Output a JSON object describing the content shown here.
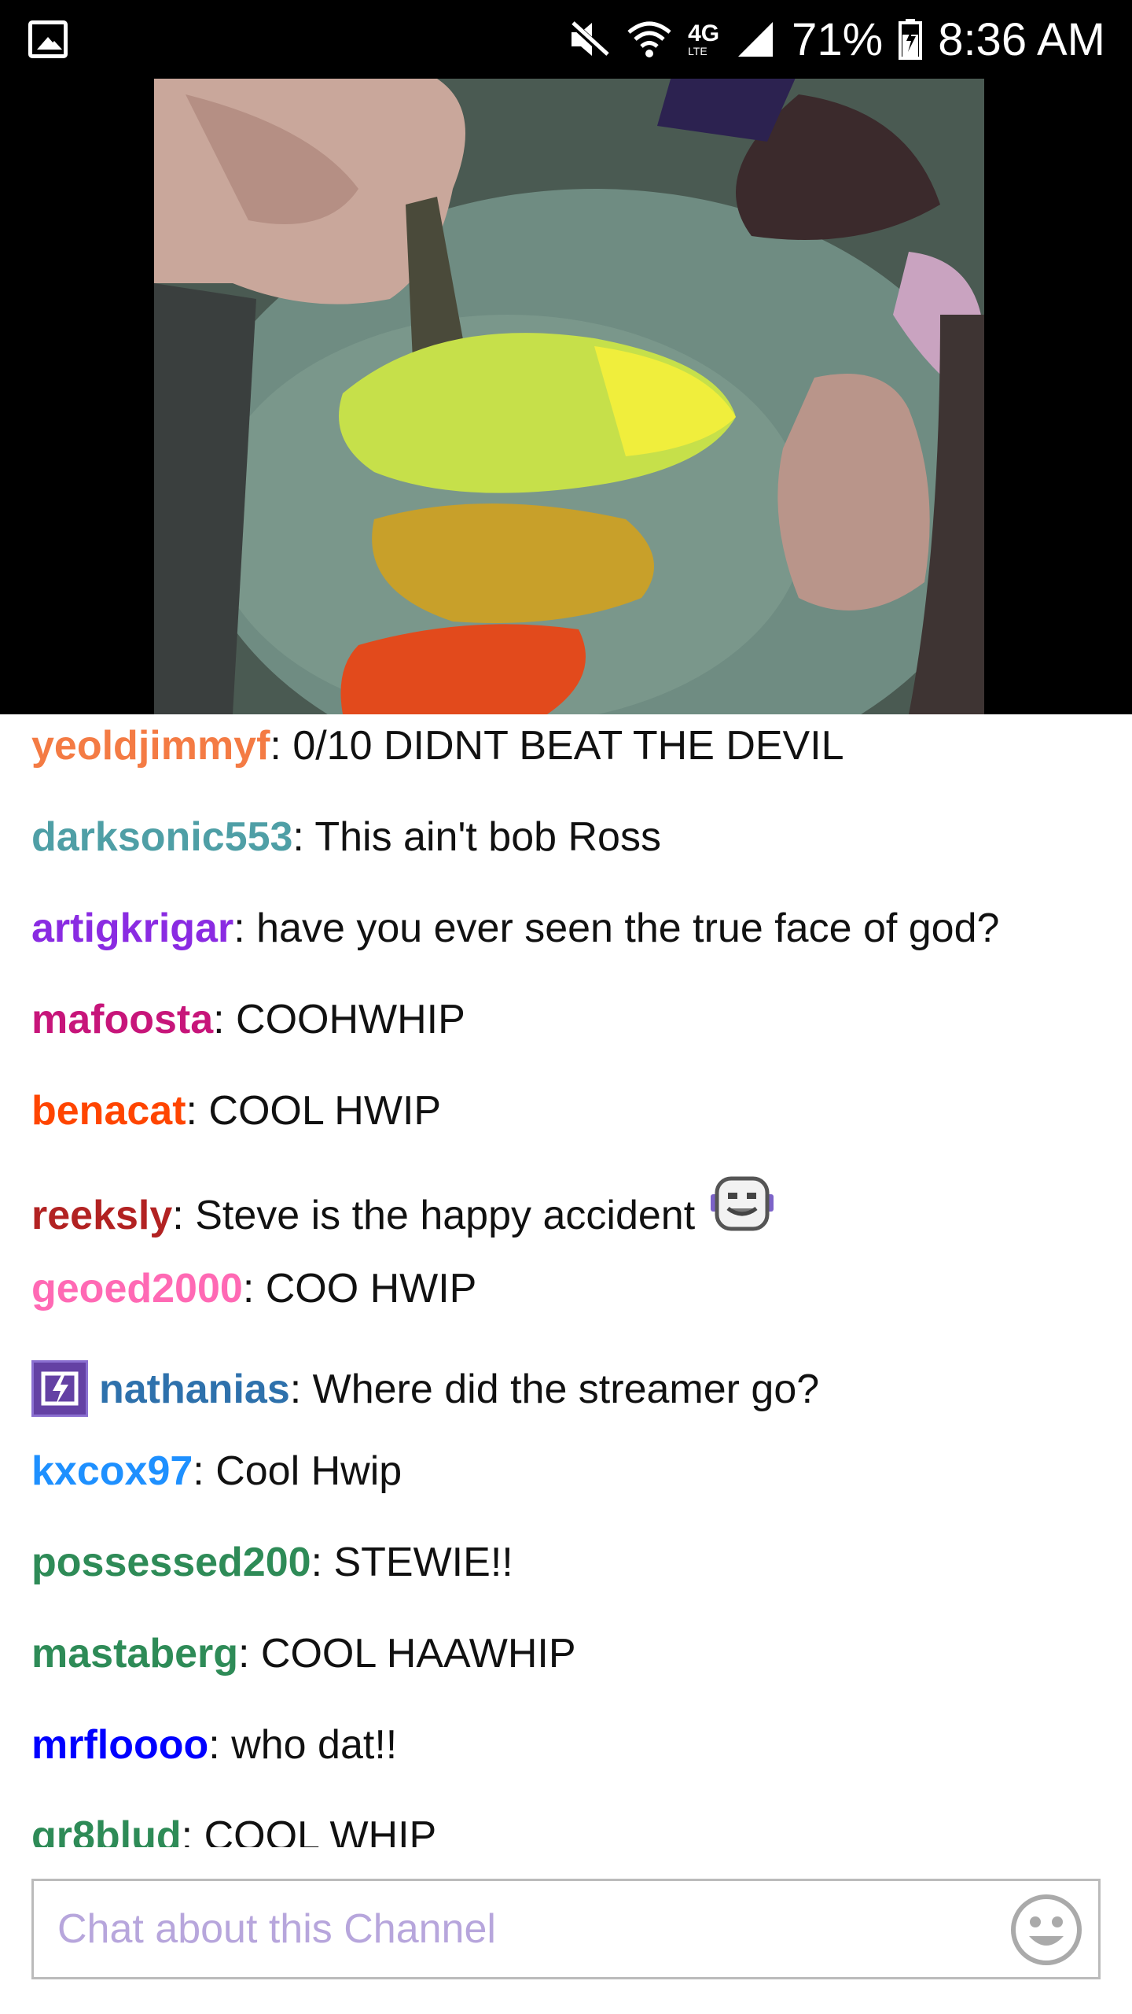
{
  "status_bar": {
    "network": "4G",
    "network_sub": "LTE",
    "battery": "71%",
    "time": "8:36 AM"
  },
  "chat": {
    "messages": [
      {
        "user": "yeoldjimmyf",
        "color": "#f47b44",
        "text": ": 0/10 DIDNT BEAT THE DEVIL"
      },
      {
        "user": "darksonic553",
        "color": "#4f9fa6",
        "text": ": This ain't bob Ross"
      },
      {
        "user": "artigkrigar",
        "color": "#8a2be2",
        "text": ": have you ever seen the true face of god?"
      },
      {
        "user": "mafoosta",
        "color": "#c7157a",
        "text": ": COOHWHIP"
      },
      {
        "user": "benacat",
        "color": "#ff4500",
        "text": ": COOL HWIP"
      },
      {
        "user": "reeksly",
        "color": "#b22222",
        "text": ": Steve is the happy accident",
        "emote": "robot-face-emote"
      },
      {
        "user": "geoed2000",
        "color": "#ff69b4",
        "text": ": COO HWIP"
      },
      {
        "user": "nathanias",
        "color": "#2e71ac",
        "text": ": Where did the streamer go?",
        "badge": "turbo-badge"
      },
      {
        "user": "kxcox97",
        "color": "#1e90ff",
        "text": ": Cool Hwip"
      },
      {
        "user": "possessed200",
        "color": "#2e8b57",
        "text": ": STEWIE!!"
      },
      {
        "user": "mastaberg",
        "color": "#2e8b57",
        "text": ": COOL HAAWHIP"
      },
      {
        "user": "mrfloooo",
        "color": "#0000ff",
        "text": ": who dat!!"
      },
      {
        "user": "gr8blud",
        "color": "#2e8b57",
        "text": ": COOL WHIP"
      }
    ]
  },
  "chat_input": {
    "placeholder": "Chat about this Channel",
    "value": ""
  },
  "icons": {
    "status_left": "gallery-icon",
    "mute": "mute-icon",
    "wifi": "wifi-icon",
    "signal": "signal-icon",
    "battery": "battery-icon",
    "emoji": "emoji-icon"
  }
}
